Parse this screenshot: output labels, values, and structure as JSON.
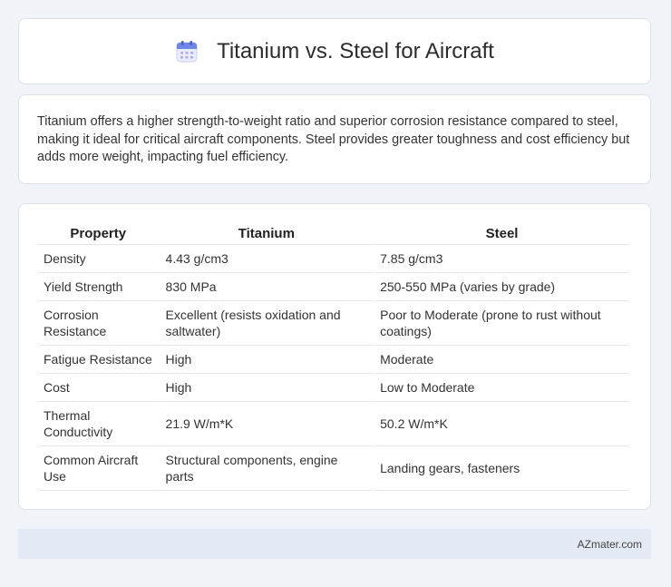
{
  "header": {
    "title": "Titanium vs. Steel for Aircraft",
    "icon": "calendar-icon"
  },
  "summary": "Titanium offers a higher strength-to-weight ratio and superior corrosion resistance compared to steel, making it ideal for critical aircraft components. Steel provides greater toughness and cost efficiency but adds more weight, impacting fuel efficiency.",
  "table": {
    "headers": [
      "Property",
      "Titanium",
      "Steel"
    ],
    "rows": [
      [
        "Density",
        "4.43 g/cm3",
        "7.85 g/cm3"
      ],
      [
        "Yield Strength",
        "830 MPa",
        "250-550 MPa (varies by grade)"
      ],
      [
        "Corrosion Resistance",
        "Excellent (resists oxidation and saltwater)",
        "Poor to Moderate (prone to rust without coatings)"
      ],
      [
        "Fatigue Resistance",
        "High",
        "Moderate"
      ],
      [
        "Cost",
        "High",
        "Low to Moderate"
      ],
      [
        "Thermal Conductivity",
        "21.9 W/m*K",
        "50.2 W/m*K"
      ],
      [
        "Common Aircraft Use",
        "Structural components, engine parts",
        "Landing gears, fasteners"
      ]
    ]
  },
  "footer": {
    "text": "AZmater.com"
  }
}
